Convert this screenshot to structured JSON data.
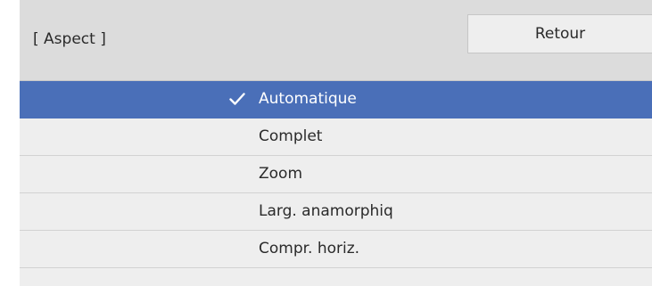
{
  "header": {
    "title": "[ Aspect ]",
    "back_label": "Retour"
  },
  "options": [
    {
      "label": "Automatique",
      "selected": true
    },
    {
      "label": "Complet",
      "selected": false
    },
    {
      "label": "Zoom",
      "selected": false
    },
    {
      "label": "Larg. anamorphiq",
      "selected": false
    },
    {
      "label": "Compr. horiz.",
      "selected": false
    }
  ],
  "colors": {
    "selection": "#4a6fb8",
    "background": "#eeeeee",
    "header": "#dcdcdc"
  },
  "icons": {
    "selected_marker": "check-icon"
  }
}
